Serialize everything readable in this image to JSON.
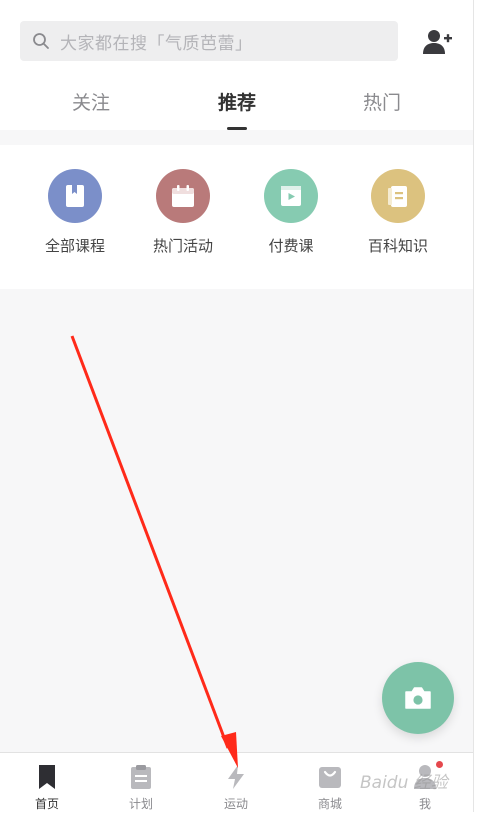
{
  "search": {
    "placeholder": "大家都在搜「气质芭蕾」"
  },
  "tabs": [
    {
      "label": "关注",
      "active": false
    },
    {
      "label": "推荐",
      "active": true
    },
    {
      "label": "热门",
      "active": false
    }
  ],
  "categories": [
    {
      "label": "全部课程",
      "icon": "book-icon",
      "color": "#7b8fc9"
    },
    {
      "label": "热门活动",
      "icon": "calendar-icon",
      "color": "#b97a7a"
    },
    {
      "label": "付费课",
      "icon": "video-icon",
      "color": "#86cbb1"
    },
    {
      "label": "百科知识",
      "icon": "notebook-icon",
      "color": "#dcc27f"
    }
  ],
  "fab": {
    "icon": "camera-icon",
    "color": "#7dc3a8"
  },
  "bottom_nav": [
    {
      "label": "首页",
      "icon": "bookmark-icon",
      "active": true
    },
    {
      "label": "计划",
      "icon": "clipboard-icon",
      "active": false
    },
    {
      "label": "运动",
      "icon": "lightning-icon",
      "active": false
    },
    {
      "label": "商城",
      "icon": "shopping-bag-icon",
      "active": false
    },
    {
      "label": "我",
      "icon": "user-icon",
      "active": false,
      "badge": true
    }
  ],
  "watermark": "Baidu 经验",
  "colors": {
    "accent": "#7dc3a8",
    "annotation": "#ff2a1a"
  }
}
